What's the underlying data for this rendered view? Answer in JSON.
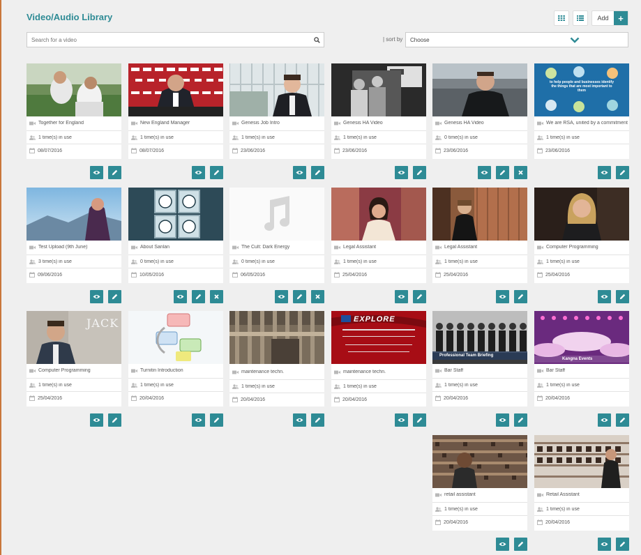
{
  "header": {
    "title": "Video/Audio Library",
    "add_label": "Add"
  },
  "search": {
    "placeholder": "Search for a video",
    "value": ""
  },
  "sort": {
    "label": "| sort by",
    "selected": "Choose"
  },
  "theme": {
    "accent": "#2e8b95",
    "card_bg": "#ffffff",
    "page_bg": "#efefef"
  },
  "items": [
    {
      "title": "Together for England",
      "usage": "1 time(s) in use",
      "date": "08/07/2016",
      "thumb": "football",
      "actions": [
        "view",
        "edit"
      ]
    },
    {
      "title": "New England Manager",
      "usage": "1 time(s) in use",
      "date": "08/07/2016",
      "thumb": "press",
      "actions": [
        "view",
        "edit"
      ]
    },
    {
      "title": "Genesis Job Intro",
      "usage": "1 time(s) in use",
      "date": "23/06/2016",
      "thumb": "office-window",
      "actions": [
        "view",
        "edit"
      ]
    },
    {
      "title": "Genesis HA Video",
      "usage": "1 time(s) in use",
      "date": "23/06/2016",
      "thumb": "bw-photo",
      "actions": [
        "view",
        "edit"
      ]
    },
    {
      "title": "Genesis HA Video",
      "usage": "0 time(s) in use",
      "date": "23/06/2016",
      "thumb": "man-city",
      "actions": [
        "view",
        "edit",
        "delete"
      ]
    },
    {
      "title": "We are RSA, united by a commitment to",
      "usage": "1 time(s) in use",
      "date": "23/06/2016",
      "thumb": "rsa",
      "thumb_text": "to help people and businesses identify the things that are most important to them",
      "actions": [
        "view",
        "edit"
      ]
    },
    {
      "title": "Test Upload (9th June)",
      "usage": "3 time(s) in use",
      "date": "09/06/2016",
      "thumb": "singer",
      "actions": [
        "view",
        "edit"
      ]
    },
    {
      "title": "About Sanlan",
      "usage": "0 time(s) in use",
      "date": "10/05/2016",
      "thumb": "sanlan",
      "actions": [
        "view",
        "edit",
        "delete"
      ]
    },
    {
      "title": "The Cult: Dark Energy",
      "usage": "0 time(s) in use",
      "date": "06/05/2016",
      "thumb": "audio",
      "actions": [
        "view",
        "edit",
        "delete"
      ]
    },
    {
      "title": "Legal Assistant",
      "usage": "1 time(s) in use",
      "date": "25/04/2016",
      "thumb": "legal-pink",
      "actions": [
        "view",
        "edit"
      ]
    },
    {
      "title": "Legal Assistant",
      "usage": "1 time(s) in use",
      "date": "25/04/2016",
      "thumb": "legal-office",
      "actions": [
        "view",
        "edit"
      ]
    },
    {
      "title": "Computer Programming",
      "usage": "1 time(s) in use",
      "date": "25/04/2016",
      "thumb": "blonde",
      "actions": [
        "view",
        "edit"
      ]
    },
    {
      "title": "Computer Programming",
      "usage": "1 time(s) in use",
      "date": "25/04/2016",
      "thumb": "jack",
      "thumb_text": "JACK",
      "actions": [
        "view",
        "edit"
      ]
    },
    {
      "title": "Turnitin Introduction",
      "usage": "1 time(s) in use",
      "date": "20/04/2016",
      "thumb": "turnitin",
      "actions": [
        "view",
        "edit"
      ]
    },
    {
      "title": "maintenance techn.",
      "usage": "1 time(s) in use",
      "date": "20/04/2016",
      "thumb": "pipes",
      "actions": [
        "view",
        "edit"
      ]
    },
    {
      "title": "maintenance techn.",
      "usage": "1 time(s) in use",
      "date": "20/04/2016",
      "thumb": "explore",
      "thumb_text": "EXPLORE",
      "actions": [
        "view",
        "edit"
      ]
    },
    {
      "title": "Bar Staff",
      "usage": "1 time(s) in use",
      "date": "20/04/2016",
      "thumb": "bar-staff",
      "thumb_text": "Professional Team  Briefing",
      "actions": [
        "view",
        "edit"
      ]
    },
    {
      "title": "Bar Staff",
      "usage": "1 time(s) in use",
      "date": "20/04/2016",
      "thumb": "events",
      "thumb_text": "Kangna Events",
      "actions": [
        "view",
        "edit"
      ]
    },
    {
      "title": "retail assistant",
      "usage": "1 time(s) in use",
      "date": "20/04/2016",
      "thumb": "retail1",
      "actions": [
        "view",
        "edit"
      ]
    },
    {
      "title": "Retail Assistant",
      "usage": "1 time(s) in use",
      "date": "20/04/2016",
      "thumb": "retail2",
      "actions": [
        "view",
        "edit"
      ]
    }
  ]
}
